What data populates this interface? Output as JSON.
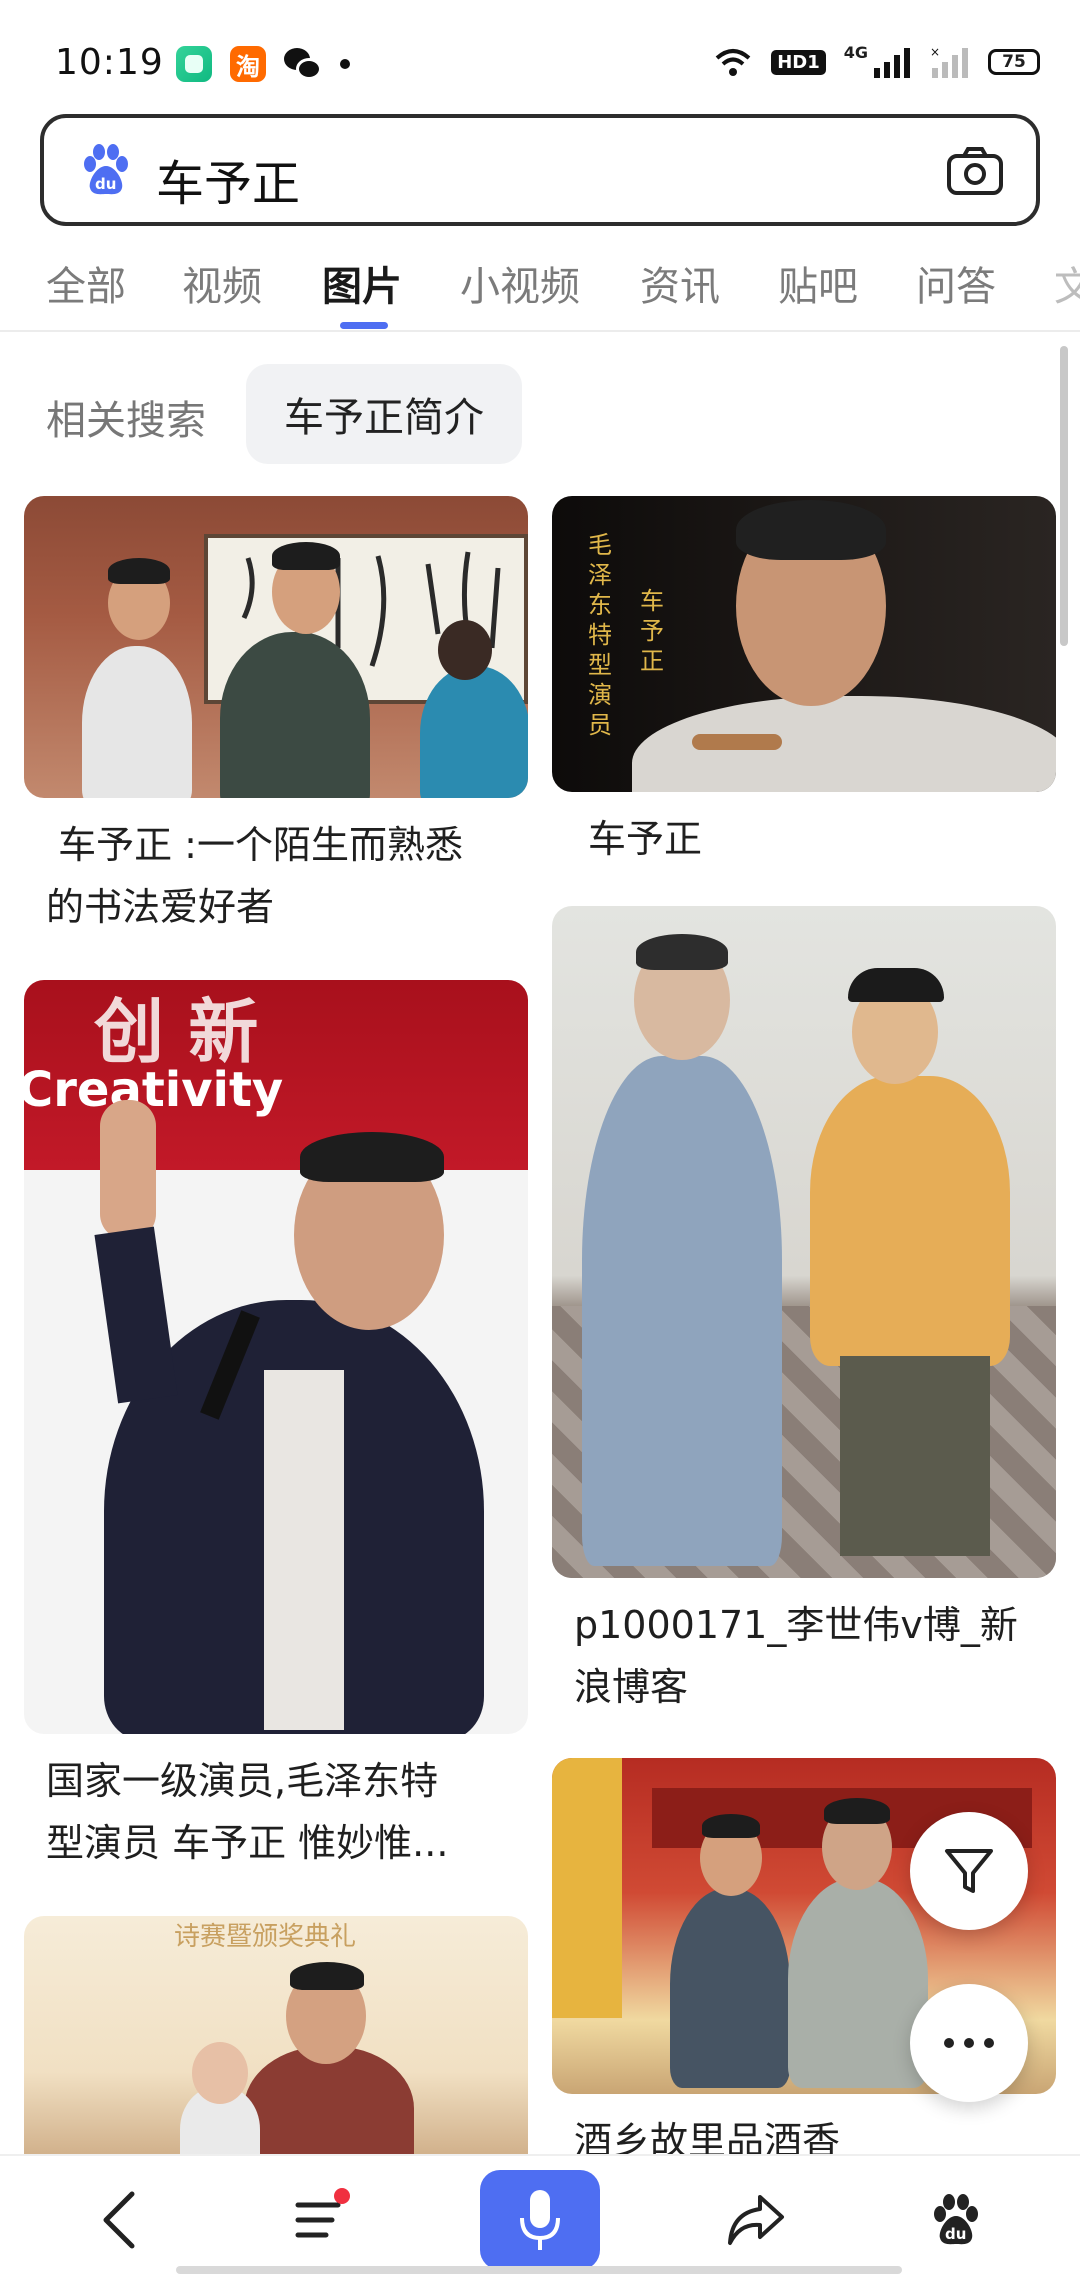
{
  "status_bar": {
    "time": "10:19",
    "app_taobao_glyph": "淘",
    "hd_label": "HD1",
    "network_label": "4G",
    "battery": "75"
  },
  "search": {
    "query": "车予正"
  },
  "tabs": [
    {
      "label": "全部"
    },
    {
      "label": "视频"
    },
    {
      "label": "图片",
      "active": true
    },
    {
      "label": "小视频"
    },
    {
      "label": "资讯"
    },
    {
      "label": "贴吧"
    },
    {
      "label": "问答"
    },
    {
      "label": "文"
    }
  ],
  "related": {
    "label": "相关搜索",
    "chip": "车予正简介"
  },
  "results": [
    {
      "caption_line1": " 车予正 :一个陌生而熟悉",
      "caption_line2": "的书法爱好者"
    },
    {
      "caption_line1": "车予正",
      "overlay_text_1": "毛泽东特型演员",
      "overlay_text_2": "车予正"
    },
    {
      "caption_line1": "国家一级演员,毛泽东特",
      "caption_line2": "型演员 车予正 惟妙惟...",
      "banner_text_1": "创 新",
      "banner_text_2": "Creativity"
    },
    {
      "caption_line1": "p1000171_李世伟v博_新",
      "caption_line2": "浪博客"
    },
    {
      "banner_text": "诗赛暨颁奖典礼"
    },
    {
      "caption_line1": "酒乡故里品酒香"
    }
  ],
  "icons": {
    "filter": "filter-icon",
    "more": "more-icon",
    "back": "chevron-left-icon",
    "menu": "menu-icon",
    "voice": "microphone-icon",
    "share": "share-icon",
    "home": "baidu-paw-icon"
  },
  "colors": {
    "accent": "#4e6ef2",
    "notification": "#f03040"
  }
}
